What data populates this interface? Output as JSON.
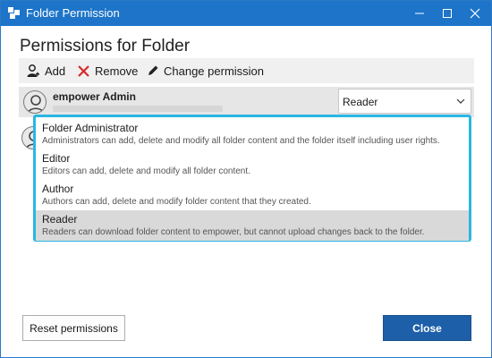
{
  "window": {
    "title": "Folder Permission",
    "icons": {
      "app": "app-icon",
      "minimize": "minimize-icon",
      "maximize": "maximize-icon",
      "close": "close-icon"
    }
  },
  "heading": "Permissions for Folder",
  "toolbar": {
    "add_label": "Add",
    "remove_label": "Remove",
    "change_label": "Change permission",
    "icons": {
      "add": "add-user-icon",
      "remove": "x-icon",
      "change": "pencil-icon"
    },
    "colors": {
      "remove_icon": "#d62a2a"
    }
  },
  "users": [
    {
      "name": "empower Admin",
      "role": "Reader",
      "avatar_icon": "user-avatar-icon"
    }
  ],
  "role_select": {
    "value": "Reader",
    "icon": "chevron-down-icon"
  },
  "role_options": [
    {
      "name": "Folder Administrator",
      "description": "Administrators can add, delete and modify all folder content and the folder itself including user rights."
    },
    {
      "name": "Editor",
      "description": "Editors can add, delete and modify all folder content."
    },
    {
      "name": "Author",
      "description": "Authors can add, delete and modify folder content that they created."
    },
    {
      "name": "Reader",
      "description": "Readers can download folder content to empower, but cannot upload changes back to the folder.",
      "selected": true
    }
  ],
  "footer": {
    "reset_label": "Reset permissions",
    "close_label": "Close"
  },
  "colors": {
    "titlebar": "#1d74c9",
    "dropdown_border": "#29b6e3",
    "close_button": "#1d5fa8",
    "selected_option": "#d9d9d9"
  }
}
